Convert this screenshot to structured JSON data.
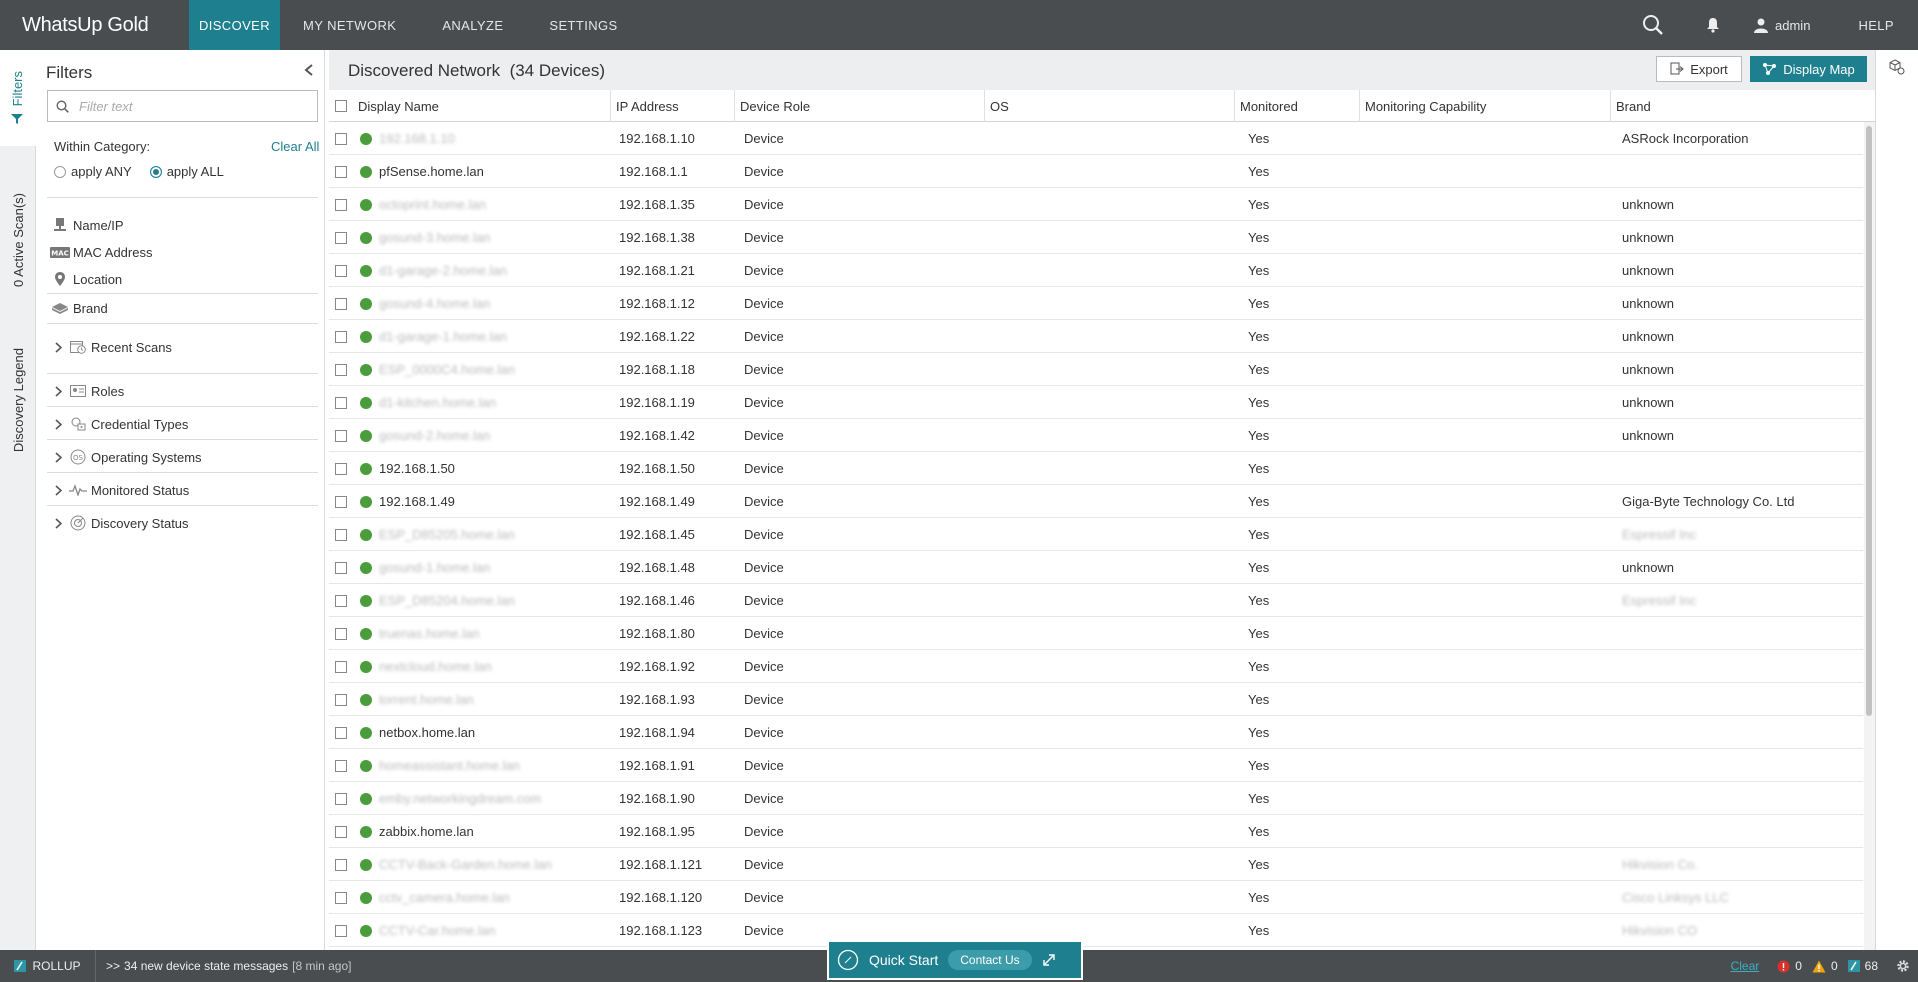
{
  "app": {
    "title": "WhatsUp Gold"
  },
  "nav": {
    "items": [
      {
        "label": "DISCOVER",
        "active": true
      },
      {
        "label": "MY NETWORK",
        "active": false
      },
      {
        "label": "ANALYZE",
        "active": false
      },
      {
        "label": "SETTINGS",
        "active": false
      }
    ],
    "user": "admin",
    "help": "HELP"
  },
  "rail": {
    "tabs": [
      "Filters",
      "0 Active Scan(s)",
      "Discovery Legend"
    ]
  },
  "filters": {
    "title": "Filters",
    "search_placeholder": "Filter text",
    "within_label": "Within Category:",
    "clear_all": "Clear All",
    "apply_any": "apply ANY",
    "apply_all": "apply ALL",
    "selected_mode": "apply ALL",
    "fields": [
      {
        "label": "Name/IP",
        "icon": "server-icon"
      },
      {
        "label": "MAC Address",
        "icon": "mac-icon"
      },
      {
        "label": "Location",
        "icon": "location-pin-icon"
      },
      {
        "label": "Brand",
        "icon": "brand-icon"
      }
    ],
    "groups": [
      {
        "label": "Recent Scans",
        "icon": "calendar-clock-icon"
      },
      {
        "label": "Roles",
        "icon": "roles-icon"
      },
      {
        "label": "Credential Types",
        "icon": "credential-icon"
      },
      {
        "label": "Operating Systems",
        "icon": "os-icon"
      },
      {
        "label": "Monitored Status",
        "icon": "pulse-icon"
      },
      {
        "label": "Discovery Status",
        "icon": "discovery-icon"
      }
    ]
  },
  "main": {
    "title": "Discovered Network",
    "count": "(34 Devices)",
    "export_label": "Export",
    "display_map_label": "Display Map",
    "columns": [
      "Display Name",
      "IP Address",
      "Device Role",
      "OS",
      "Monitored",
      "Monitoring Capability",
      "Brand"
    ],
    "rows": [
      {
        "name": "192.168.1.10",
        "blur_name": true,
        "ip": "192.168.1.10",
        "role": "Device",
        "os": "",
        "monitored": "Yes",
        "capability": "",
        "brand": "ASRock Incorporation",
        "blur_brand": false
      },
      {
        "name": "pfSense.home.lan",
        "blur_name": false,
        "ip": "192.168.1.1",
        "role": "Device",
        "os": "",
        "monitored": "Yes",
        "capability": "",
        "brand": "",
        "blur_brand": false
      },
      {
        "name": "octoprint.home.lan",
        "blur_name": true,
        "ip": "192.168.1.35",
        "role": "Device",
        "os": "",
        "monitored": "Yes",
        "capability": "",
        "brand": "unknown",
        "blur_brand": false
      },
      {
        "name": "gosund-3.home.lan",
        "blur_name": true,
        "ip": "192.168.1.38",
        "role": "Device",
        "os": "",
        "monitored": "Yes",
        "capability": "",
        "brand": "unknown",
        "blur_brand": false
      },
      {
        "name": "d1-garage-2.home.lan",
        "blur_name": true,
        "ip": "192.168.1.21",
        "role": "Device",
        "os": "",
        "monitored": "Yes",
        "capability": "",
        "brand": "unknown",
        "blur_brand": false
      },
      {
        "name": "gosund-4.home.lan",
        "blur_name": true,
        "ip": "192.168.1.12",
        "role": "Device",
        "os": "",
        "monitored": "Yes",
        "capability": "",
        "brand": "unknown",
        "blur_brand": false
      },
      {
        "name": "d1-garage-1.home.lan",
        "blur_name": true,
        "ip": "192.168.1.22",
        "role": "Device",
        "os": "",
        "monitored": "Yes",
        "capability": "",
        "brand": "unknown",
        "blur_brand": false
      },
      {
        "name": "ESP_0000C4.home.lan",
        "blur_name": true,
        "ip": "192.168.1.18",
        "role": "Device",
        "os": "",
        "monitored": "Yes",
        "capability": "",
        "brand": "unknown",
        "blur_brand": false
      },
      {
        "name": "d1-kitchen.home.lan",
        "blur_name": true,
        "ip": "192.168.1.19",
        "role": "Device",
        "os": "",
        "monitored": "Yes",
        "capability": "",
        "brand": "unknown",
        "blur_brand": false
      },
      {
        "name": "gosund-2.home.lan",
        "blur_name": true,
        "ip": "192.168.1.42",
        "role": "Device",
        "os": "",
        "monitored": "Yes",
        "capability": "",
        "brand": "unknown",
        "blur_brand": false
      },
      {
        "name": "192.168.1.50",
        "blur_name": false,
        "ip": "192.168.1.50",
        "role": "Device",
        "os": "",
        "monitored": "Yes",
        "capability": "",
        "brand": "",
        "blur_brand": false
      },
      {
        "name": "192.168.1.49",
        "blur_name": false,
        "ip": "192.168.1.49",
        "role": "Device",
        "os": "",
        "monitored": "Yes",
        "capability": "",
        "brand": "Giga-Byte Technology Co. Ltd",
        "blur_brand": false
      },
      {
        "name": "ESP_D85205.home.lan",
        "blur_name": true,
        "ip": "192.168.1.45",
        "role": "Device",
        "os": "",
        "monitored": "Yes",
        "capability": "",
        "brand": "Espressif Inc",
        "blur_brand": true
      },
      {
        "name": "gosund-1.home.lan",
        "blur_name": true,
        "ip": "192.168.1.48",
        "role": "Device",
        "os": "",
        "monitored": "Yes",
        "capability": "",
        "brand": "unknown",
        "blur_brand": false
      },
      {
        "name": "ESP_D85204.home.lan",
        "blur_name": true,
        "ip": "192.168.1.46",
        "role": "Device",
        "os": "",
        "monitored": "Yes",
        "capability": "",
        "brand": "Espressif Inc",
        "blur_brand": true
      },
      {
        "name": "truenas.home.lan",
        "blur_name": true,
        "ip": "192.168.1.80",
        "role": "Device",
        "os": "",
        "monitored": "Yes",
        "capability": "",
        "brand": "",
        "blur_brand": false
      },
      {
        "name": "nextcloud.home.lan",
        "blur_name": true,
        "ip": "192.168.1.92",
        "role": "Device",
        "os": "",
        "monitored": "Yes",
        "capability": "",
        "brand": "",
        "blur_brand": false
      },
      {
        "name": "torrent.home.lan",
        "blur_name": true,
        "ip": "192.168.1.93",
        "role": "Device",
        "os": "",
        "monitored": "Yes",
        "capability": "",
        "brand": "",
        "blur_brand": false
      },
      {
        "name": "netbox.home.lan",
        "blur_name": false,
        "ip": "192.168.1.94",
        "role": "Device",
        "os": "",
        "monitored": "Yes",
        "capability": "",
        "brand": "",
        "blur_brand": false
      },
      {
        "name": "homeassistant.home.lan",
        "blur_name": true,
        "ip": "192.168.1.91",
        "role": "Device",
        "os": "",
        "monitored": "Yes",
        "capability": "",
        "brand": "",
        "blur_brand": false
      },
      {
        "name": "emby.networkingdream.com",
        "blur_name": true,
        "ip": "192.168.1.90",
        "role": "Device",
        "os": "",
        "monitored": "Yes",
        "capability": "",
        "brand": "",
        "blur_brand": false
      },
      {
        "name": "zabbix.home.lan",
        "blur_name": false,
        "ip": "192.168.1.95",
        "role": "Device",
        "os": "",
        "monitored": "Yes",
        "capability": "",
        "brand": "",
        "blur_brand": false
      },
      {
        "name": "CCTV-Back-Garden.home.lan",
        "blur_name": true,
        "ip": "192.168.1.121",
        "role": "Device",
        "os": "",
        "monitored": "Yes",
        "capability": "",
        "brand": "Hikvision Co.",
        "blur_brand": true
      },
      {
        "name": "cctv_camera.home.lan",
        "blur_name": true,
        "ip": "192.168.1.120",
        "role": "Device",
        "os": "",
        "monitored": "Yes",
        "capability": "",
        "brand": "Cisco Linksys LLC",
        "blur_brand": true
      },
      {
        "name": "CCTV-Car.home.lan",
        "blur_name": true,
        "ip": "192.168.1.123",
        "role": "Device",
        "os": "",
        "monitored": "Yes",
        "capability": "",
        "brand": "Hikvision CO",
        "blur_brand": true
      }
    ]
  },
  "status": {
    "rollup": "ROLLUP",
    "prefix": ">>",
    "message": "34 new device state messages",
    "ago": "[8 min ago]",
    "quick_start": "Quick Start",
    "contact_us": "Contact Us",
    "clear": "Clear",
    "errors": "0",
    "warnings": "0",
    "rollup_count": "68"
  },
  "colors": {
    "accent": "#1e7f8f",
    "topbar": "#4a4d50",
    "up": "#4a9d3a"
  }
}
